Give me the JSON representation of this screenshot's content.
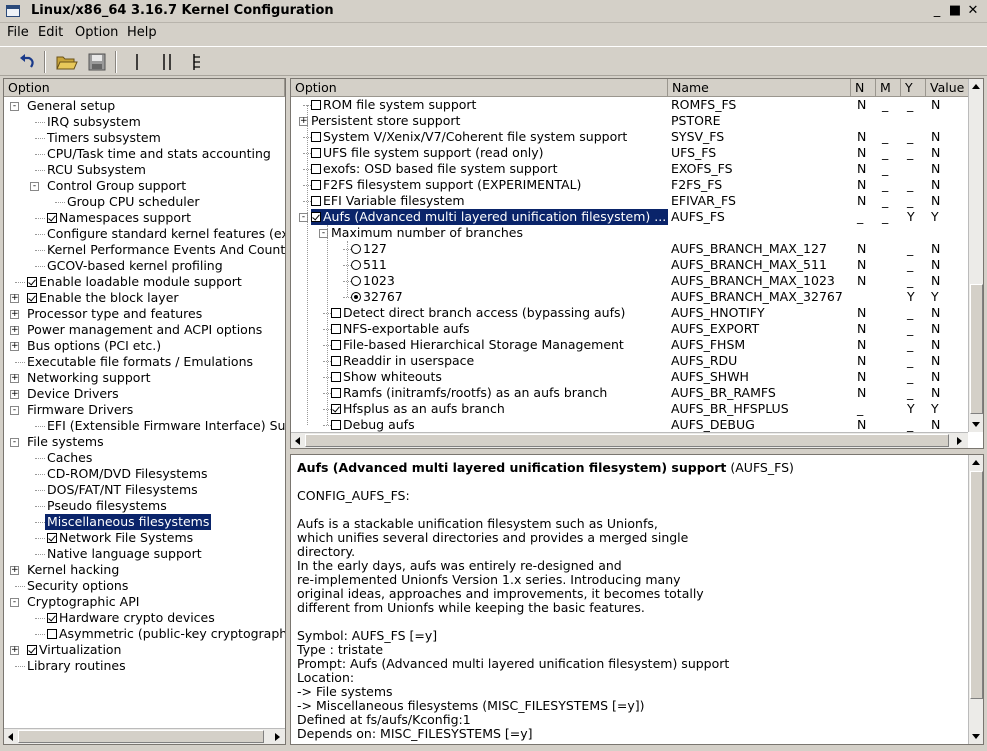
{
  "window": {
    "title": "Linux/x86_64 3.16.7 Kernel Configuration",
    "minimize": "_",
    "maximize": "■",
    "close": "✕"
  },
  "menubar": {
    "file": "File",
    "edit": "Edit",
    "option": "Option",
    "help": "Help"
  },
  "tree": {
    "header": "Option",
    "items": [
      {
        "label": "General setup",
        "level": 0,
        "expander": "-",
        "check": null
      },
      {
        "label": "IRQ subsystem",
        "level": 1,
        "expander": null,
        "check": null
      },
      {
        "label": "Timers subsystem",
        "level": 1,
        "expander": null,
        "check": null
      },
      {
        "label": "CPU/Task time and stats accounting",
        "level": 1,
        "expander": null,
        "check": null
      },
      {
        "label": "RCU Subsystem",
        "level": 1,
        "expander": null,
        "check": null
      },
      {
        "label": "Control Group support",
        "level": 1,
        "expander": "-",
        "check": null
      },
      {
        "label": "Group CPU scheduler",
        "level": 2,
        "expander": null,
        "check": null
      },
      {
        "label": "Namespaces support",
        "level": 1,
        "expander": null,
        "check": "on"
      },
      {
        "label": "Configure standard kernel features (ex",
        "level": 1,
        "expander": null,
        "check": null
      },
      {
        "label": "Kernel Performance Events And Counte",
        "level": 1,
        "expander": null,
        "check": null
      },
      {
        "label": "GCOV-based kernel profiling",
        "level": 1,
        "expander": null,
        "check": null
      },
      {
        "label": "Enable loadable module support",
        "level": 0,
        "expander": null,
        "check": "on"
      },
      {
        "label": "Enable the block layer",
        "level": 0,
        "expander": "+",
        "check": "on"
      },
      {
        "label": "Processor type and features",
        "level": 0,
        "expander": "+",
        "check": null
      },
      {
        "label": "Power management and ACPI options",
        "level": 0,
        "expander": "+",
        "check": null
      },
      {
        "label": "Bus options (PCI etc.)",
        "level": 0,
        "expander": "+",
        "check": null
      },
      {
        "label": "Executable file formats / Emulations",
        "level": 0,
        "expander": null,
        "check": null
      },
      {
        "label": "Networking support",
        "level": 0,
        "expander": "+",
        "check": null
      },
      {
        "label": "Device Drivers",
        "level": 0,
        "expander": "+",
        "check": null
      },
      {
        "label": "Firmware Drivers",
        "level": 0,
        "expander": "-",
        "check": null
      },
      {
        "label": "EFI (Extensible Firmware Interface) Sup",
        "level": 1,
        "expander": null,
        "check": null
      },
      {
        "label": "File systems",
        "level": 0,
        "expander": "-",
        "check": null
      },
      {
        "label": "Caches",
        "level": 1,
        "expander": null,
        "check": null
      },
      {
        "label": "CD-ROM/DVD Filesystems",
        "level": 1,
        "expander": null,
        "check": null
      },
      {
        "label": "DOS/FAT/NT Filesystems",
        "level": 1,
        "expander": null,
        "check": null
      },
      {
        "label": "Pseudo filesystems",
        "level": 1,
        "expander": null,
        "check": null
      },
      {
        "label": "Miscellaneous filesystems",
        "level": 1,
        "expander": null,
        "check": null,
        "selected": true
      },
      {
        "label": "Network File Systems",
        "level": 1,
        "expander": null,
        "check": "on"
      },
      {
        "label": "Native language support",
        "level": 1,
        "expander": null,
        "check": null
      },
      {
        "label": "Kernel hacking",
        "level": 0,
        "expander": "+",
        "check": null
      },
      {
        "label": "Security options",
        "level": 0,
        "expander": null,
        "check": null
      },
      {
        "label": "Cryptographic API",
        "level": 0,
        "expander": "-",
        "check": null
      },
      {
        "label": "Hardware crypto devices",
        "level": 1,
        "expander": null,
        "check": "on"
      },
      {
        "label": "Asymmetric (public-key cryptographic",
        "level": 1,
        "expander": null,
        "check": "off"
      },
      {
        "label": "Virtualization",
        "level": 0,
        "expander": "+",
        "check": "on"
      },
      {
        "label": "Library routines",
        "level": 0,
        "expander": null,
        "check": null
      }
    ]
  },
  "list": {
    "headers": {
      "option": "Option",
      "name": "Name",
      "n": "N",
      "m": "M",
      "y": "Y",
      "value": "Value"
    },
    "rows": [
      {
        "label": "ROM file system support",
        "indent": 0,
        "expander": null,
        "check": "off",
        "name": "ROMFS_FS",
        "n": "N",
        "m": "_",
        "y": "_",
        "value": "N"
      },
      {
        "label": "Persistent store support",
        "indent": 0,
        "expander": "+",
        "check": null,
        "name": "PSTORE",
        "n": "",
        "m": "",
        "y": "",
        "value": ""
      },
      {
        "label": "System V/Xenix/V7/Coherent file system support",
        "indent": 0,
        "expander": null,
        "check": "off",
        "name": "SYSV_FS",
        "n": "N",
        "m": "_",
        "y": "_",
        "value": "N"
      },
      {
        "label": "UFS file system support (read only)",
        "indent": 0,
        "expander": null,
        "check": "off",
        "name": "UFS_FS",
        "n": "N",
        "m": "_",
        "y": "_",
        "value": "N"
      },
      {
        "label": "exofs: OSD based file system support",
        "indent": 0,
        "expander": null,
        "check": "off",
        "name": "EXOFS_FS",
        "n": "N",
        "m": "_",
        "y": "",
        "value": "N"
      },
      {
        "label": "F2FS filesystem support (EXPERIMENTAL)",
        "indent": 0,
        "expander": null,
        "check": "off",
        "name": "F2FS_FS",
        "n": "N",
        "m": "_",
        "y": "_",
        "value": "N"
      },
      {
        "label": "EFI Variable filesystem",
        "indent": 0,
        "expander": null,
        "check": "off",
        "name": "EFIVAR_FS",
        "n": "N",
        "m": "_",
        "y": "_",
        "value": "N"
      },
      {
        "label": "Aufs (Advanced multi layered unification filesystem) ...",
        "indent": 0,
        "expander": "-",
        "check": "on",
        "name": "AUFS_FS",
        "n": "_",
        "m": "_",
        "y": "Y",
        "value": "Y",
        "selected": true
      },
      {
        "label": "Maximum number of branches",
        "indent": 1,
        "expander": "-",
        "check": null,
        "name": "",
        "n": "",
        "m": "",
        "y": "",
        "value": ""
      },
      {
        "label": "127",
        "indent": 2,
        "expander": null,
        "radio": "off",
        "name": "AUFS_BRANCH_MAX_127",
        "n": "N",
        "m": "",
        "y": "_",
        "value": "N"
      },
      {
        "label": "511",
        "indent": 2,
        "expander": null,
        "radio": "off",
        "name": "AUFS_BRANCH_MAX_511",
        "n": "N",
        "m": "",
        "y": "_",
        "value": "N"
      },
      {
        "label": "1023",
        "indent": 2,
        "expander": null,
        "radio": "off",
        "name": "AUFS_BRANCH_MAX_1023",
        "n": "N",
        "m": "",
        "y": "_",
        "value": "N"
      },
      {
        "label": "32767",
        "indent": 2,
        "expander": null,
        "radio": "on",
        "name": "AUFS_BRANCH_MAX_32767",
        "n": "",
        "m": "",
        "y": "Y",
        "value": "Y"
      },
      {
        "label": "Detect direct branch access (bypassing aufs)",
        "indent": 1,
        "expander": null,
        "check": "off",
        "name": "AUFS_HNOTIFY",
        "n": "N",
        "m": "",
        "y": "_",
        "value": "N"
      },
      {
        "label": "NFS-exportable aufs",
        "indent": 1,
        "expander": null,
        "check": "off",
        "name": "AUFS_EXPORT",
        "n": "N",
        "m": "",
        "y": "_",
        "value": "N"
      },
      {
        "label": "File-based Hierarchical Storage Management",
        "indent": 1,
        "expander": null,
        "check": "off",
        "name": "AUFS_FHSM",
        "n": "N",
        "m": "",
        "y": "_",
        "value": "N"
      },
      {
        "label": "Readdir in userspace",
        "indent": 1,
        "expander": null,
        "check": "off",
        "name": "AUFS_RDU",
        "n": "N",
        "m": "",
        "y": "_",
        "value": "N"
      },
      {
        "label": "Show whiteouts",
        "indent": 1,
        "expander": null,
        "check": "off",
        "name": "AUFS_SHWH",
        "n": "N",
        "m": "",
        "y": "_",
        "value": "N"
      },
      {
        "label": "Ramfs (initramfs/rootfs) as an aufs branch",
        "indent": 1,
        "expander": null,
        "check": "off",
        "name": "AUFS_BR_RAMFS",
        "n": "N",
        "m": "",
        "y": "_",
        "value": "N"
      },
      {
        "label": "Hfsplus as an aufs branch",
        "indent": 1,
        "expander": null,
        "check": "on",
        "name": "AUFS_BR_HFSPLUS",
        "n": "_",
        "m": "",
        "y": "Y",
        "value": "Y"
      },
      {
        "label": "Debug aufs",
        "indent": 1,
        "expander": null,
        "check": "off",
        "name": "AUFS_DEBUG",
        "n": "N",
        "m": "",
        "y": "_",
        "value": "N"
      }
    ]
  },
  "help": {
    "title": "Aufs (Advanced multi layered unification filesystem) support",
    "symbol_suffix": " (AUFS_FS)",
    "body": "\nCONFIG_AUFS_FS:\n\nAufs is a stackable unification filesystem such as Unionfs,\nwhich unifies several directories and provides a merged single\ndirectory.\nIn the early days, aufs was entirely re-designed and\nre-implemented Unionfs Version 1.x series. Introducing many\noriginal ideas, approaches and improvements, it becomes totally\ndifferent from Unionfs while keeping the basic features.\n\nSymbol: AUFS_FS [=y]\nType : tristate\nPrompt: Aufs (Advanced multi layered unification filesystem) support\nLocation:\n-> File systems\n-> Miscellaneous filesystems (MISC_FILESYSTEMS [=y])\nDefined at fs/aufs/Kconfig:1\nDepends on: MISC_FILESYSTEMS [=y]"
  },
  "toolbar": {
    "icons": [
      "back-icon",
      "open-icon",
      "save-icon",
      "single-view-icon",
      "split-view-icon",
      "full-view-icon"
    ]
  }
}
